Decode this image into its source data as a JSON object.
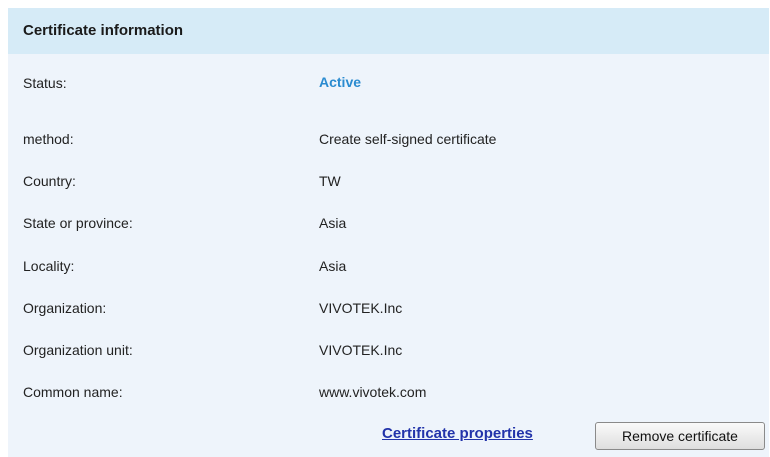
{
  "panel": {
    "title": "Certificate information"
  },
  "fields": {
    "status": {
      "label": "Status:",
      "value": "Active"
    },
    "method": {
      "label": "method:",
      "value": "Create self-signed certificate"
    },
    "country": {
      "label": "Country:",
      "value": "TW"
    },
    "state": {
      "label": "State or province:",
      "value": "Asia"
    },
    "locality": {
      "label": "Locality:",
      "value": "Asia"
    },
    "organization": {
      "label": "Organization:",
      "value": "VIVOTEK.Inc"
    },
    "org_unit": {
      "label": "Organization unit:",
      "value": "VIVOTEK.Inc"
    },
    "common_name": {
      "label": "Common name:",
      "value": "www.vivotek.com"
    }
  },
  "actions": {
    "properties_link": "Certificate properties",
    "remove_button": "Remove certificate"
  },
  "colors": {
    "header_bg": "#d6ebf7",
    "panel_bg": "#eef4fb",
    "status_active": "#2a8bd0",
    "link": "#2233aa"
  }
}
